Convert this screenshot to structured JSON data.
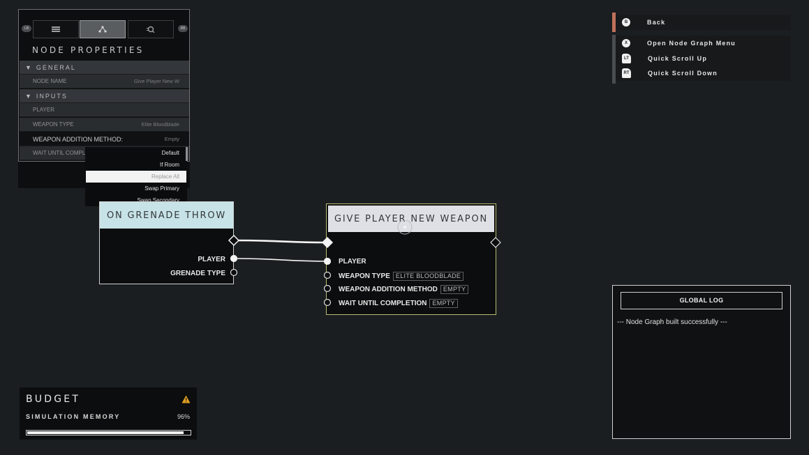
{
  "properties_panel": {
    "title": "NODE PROPERTIES",
    "tabs": [
      "list-icon",
      "graph-icon",
      "search-icon"
    ],
    "bumper_left": "LB",
    "bumper_right": "RB",
    "sections": {
      "general": "GENERAL",
      "inputs": "INPUTS"
    },
    "rows": {
      "node_name_label": "NODE NAME",
      "node_name_value": "Give Player New W",
      "player_label": "PLAYER",
      "weapon_type_label": "WEAPON TYPE",
      "weapon_type_value": "Elite Bloodblade",
      "addition_method_label": "WEAPON ADDITION METHOD:",
      "addition_method_value": "Empty",
      "wait_label": "WAIT UNTIL COMPLE"
    },
    "dropdown_options": [
      "Default",
      "If Room",
      "Replace All",
      "Swap Primary",
      "Swap Secondary"
    ],
    "dropdown_selected": "Replace All"
  },
  "nodes": {
    "grenade": {
      "title": "ON GRENADE THROW",
      "outputs": [
        "PLAYER",
        "GRENADE TYPE"
      ]
    },
    "give_weapon": {
      "title": "GIVE PLAYER NEW WEAPON",
      "inputs": {
        "player": "PLAYER",
        "weapon_type": "WEAPON TYPE",
        "weapon_type_value": "ELITE BLOODBLADE",
        "addition_method": "WEAPON ADDITION METHOD",
        "addition_method_value": "EMPTY",
        "wait": "WAIT UNTIL COMPLETION",
        "wait_value": "EMPTY"
      }
    }
  },
  "controls": [
    {
      "button": "B",
      "label": "Back",
      "accent": "#c0705c"
    },
    {
      "button": "X",
      "label": "Open Node Graph Menu",
      "accent": "#4a4d50"
    },
    {
      "button": "LT",
      "label": "Quick Scroll Up",
      "accent": "#4a4d50"
    },
    {
      "button": "RT",
      "label": "Quick Scroll Down",
      "accent": "#4a4d50"
    }
  ],
  "global_log": {
    "title": "GLOBAL LOG",
    "message": "--- Node Graph built successfully ---"
  },
  "budget": {
    "title": "BUDGET",
    "label": "SIMULATION MEMORY",
    "value": "96%",
    "fraction": 0.96,
    "warning_color": "#e0a020"
  }
}
